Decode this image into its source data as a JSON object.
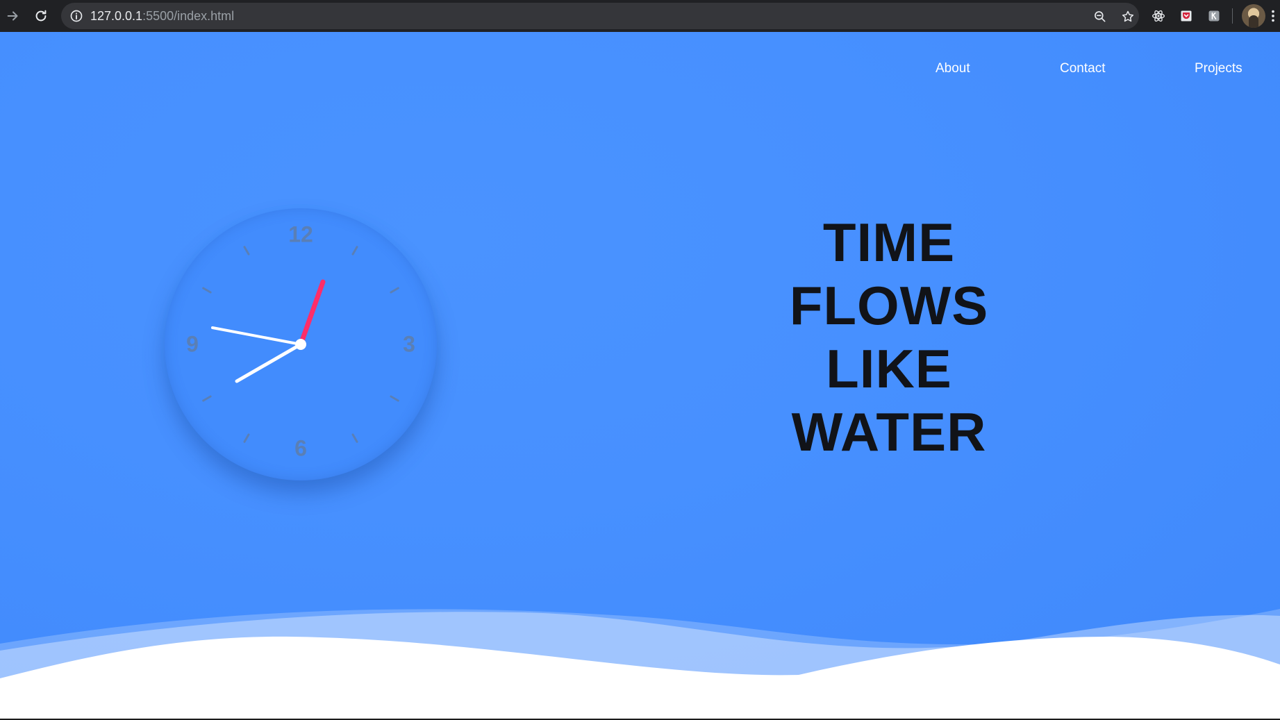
{
  "browser": {
    "url_host": "127.0.0.1",
    "url_path": ":5500/index.html",
    "icons": [
      "forward-icon",
      "reload-icon",
      "info-icon",
      "zoom-icon",
      "star-icon",
      "react-devtools-icon",
      "pocket-icon",
      "extension-icon",
      "profile-avatar",
      "more-icon"
    ]
  },
  "nav": {
    "items": [
      {
        "label": "About"
      },
      {
        "label": "Contact"
      },
      {
        "label": "Projects"
      }
    ]
  },
  "clock": {
    "numbers": [
      "12",
      "3",
      "6",
      "9"
    ],
    "colors": {
      "face": "#428cfd",
      "second_hand": "#ff2d6a",
      "hands": "#ffffff",
      "marks": "#5a7fb5"
    }
  },
  "headline": {
    "lines": [
      "TIME",
      "FLOWS",
      "LIKE",
      "WATER"
    ]
  },
  "colors": {
    "background": "#4790ff",
    "wave": "#ffffff",
    "chrome": "#202124"
  }
}
